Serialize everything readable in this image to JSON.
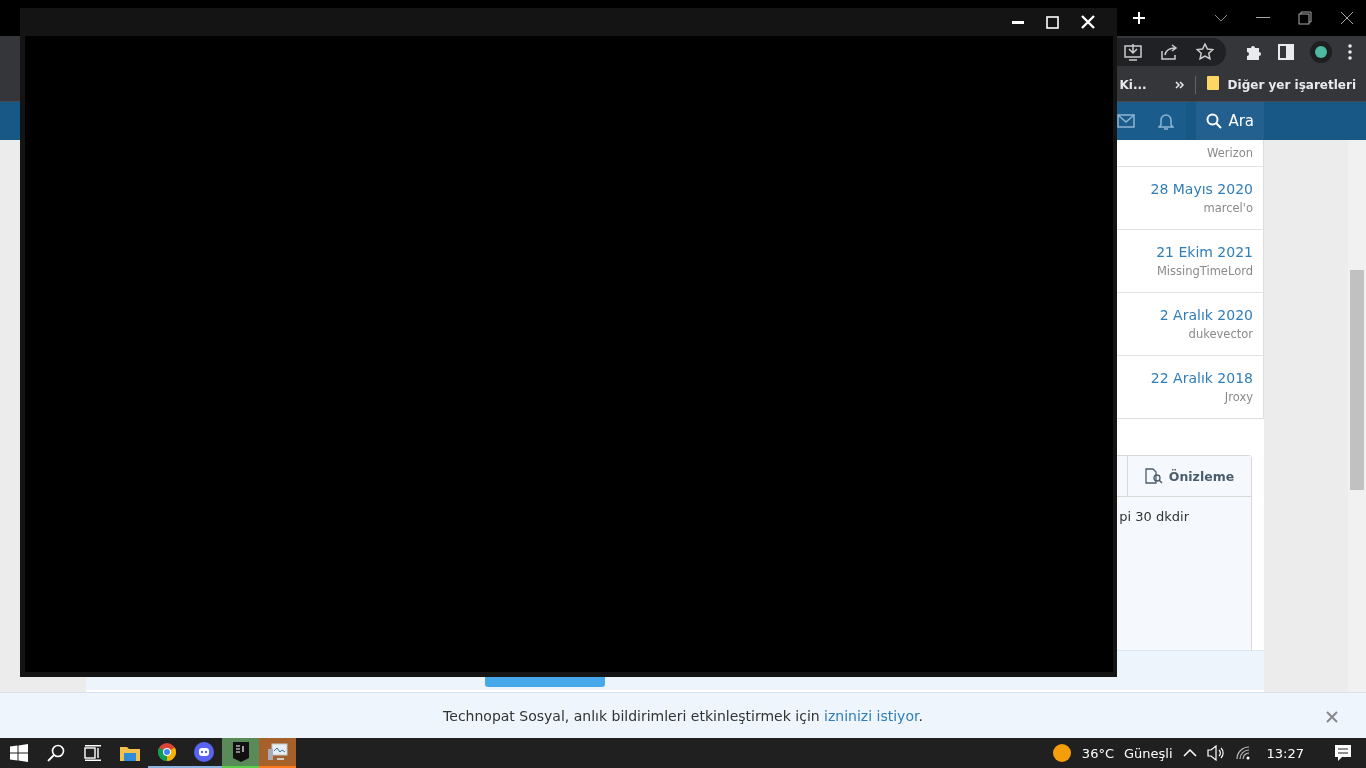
{
  "browser": {
    "bookmarks": [
      {
        "label": "Ki...",
        "kind": "plain"
      },
      {
        "label": "Diğer yer işaretleri",
        "kind": "folder"
      }
    ],
    "nav": {
      "search_label": "Ara"
    }
  },
  "page": {
    "list_rows": [
      {
        "date": "",
        "user": "Werizon"
      },
      {
        "date": "28 Mayıs 2020",
        "user": "marcel'o"
      },
      {
        "date": "21 Ekim 2021",
        "user": "MissingTimeLord"
      },
      {
        "date": "2 Aralık 2020",
        "user": "dukevector"
      },
      {
        "date": "22 Aralık 2018",
        "user": "Jroxy"
      }
    ],
    "editor": {
      "preview_tab": "Önizleme",
      "text": "pi 30 dkdir"
    }
  },
  "notification": {
    "text": "Technopat Sosyal, anlık bildirimleri etkinleştirmek için ",
    "link": "izninizi istiyor",
    "end": "."
  },
  "taskbar": {
    "temperature": "36°C",
    "weather": "Güneşli",
    "time": "13:27"
  }
}
